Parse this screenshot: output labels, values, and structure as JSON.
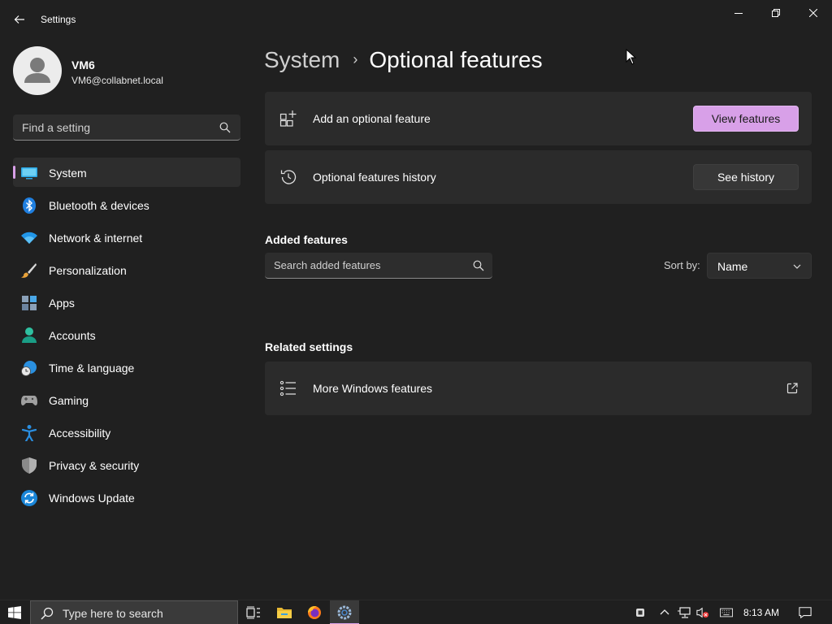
{
  "window": {
    "title": "Settings"
  },
  "profile": {
    "name": "VM6",
    "email": "VM6@collabnet.local"
  },
  "sidebar": {
    "search_placeholder": "Find a setting",
    "items": [
      {
        "label": "System",
        "icon": "monitor-icon",
        "selected": true
      },
      {
        "label": "Bluetooth & devices",
        "icon": "bluetooth-icon"
      },
      {
        "label": "Network & internet",
        "icon": "wifi-icon"
      },
      {
        "label": "Personalization",
        "icon": "paintbrush-icon"
      },
      {
        "label": "Apps",
        "icon": "apps-icon"
      },
      {
        "label": "Accounts",
        "icon": "person-icon"
      },
      {
        "label": "Time & language",
        "icon": "globe-clock-icon"
      },
      {
        "label": "Gaming",
        "icon": "gamepad-icon"
      },
      {
        "label": "Accessibility",
        "icon": "accessibility-icon"
      },
      {
        "label": "Privacy & security",
        "icon": "shield-icon"
      },
      {
        "label": "Windows Update",
        "icon": "update-icon"
      }
    ]
  },
  "breadcrumb": {
    "parent": "System",
    "separator": "›",
    "current": "Optional features"
  },
  "cards": {
    "add": {
      "label": "Add an optional feature",
      "button": "View features",
      "icon": "add-feature-icon"
    },
    "history": {
      "label": "Optional features history",
      "button": "See history",
      "icon": "history-icon"
    }
  },
  "added_features": {
    "title": "Added features",
    "search_placeholder": "Search added features",
    "sort_label": "Sort by:",
    "sort_value": "Name"
  },
  "related": {
    "title": "Related settings",
    "more_windows_features": {
      "label": "More Windows features",
      "icon": "list-icon",
      "action_icon": "open-external-icon"
    }
  },
  "taskbar": {
    "search_placeholder": "Type here to search",
    "clock": "8:13 AM"
  },
  "colors": {
    "accent": "#d8a0e8",
    "background": "#202020",
    "card": "#2b2b2b"
  }
}
